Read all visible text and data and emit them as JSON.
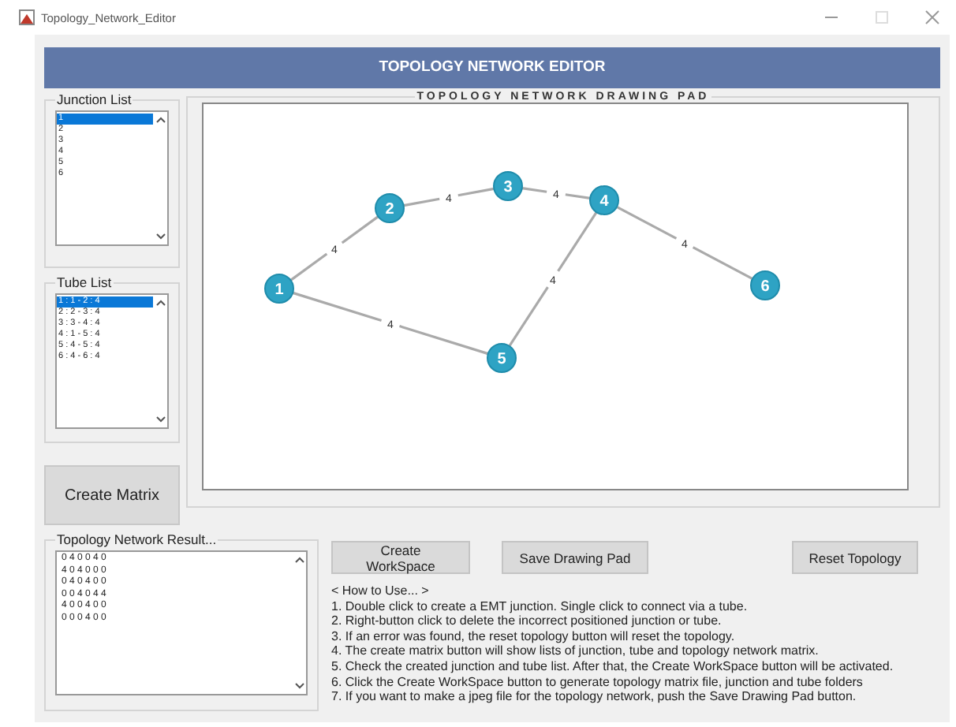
{
  "window": {
    "title": "Topology_Network_Editor"
  },
  "header": {
    "title": "TOPOLOGY NETWORK EDITOR"
  },
  "junction_list": {
    "title": "Junction List",
    "items": [
      {
        "label": "1",
        "selected": true
      },
      {
        "label": "2",
        "selected": false
      },
      {
        "label": "3",
        "selected": false
      },
      {
        "label": "4",
        "selected": false
      },
      {
        "label": "5",
        "selected": false
      },
      {
        "label": "6",
        "selected": false
      }
    ]
  },
  "tube_list": {
    "title": "Tube List",
    "items": [
      {
        "label": "1 : 1 - 2 : 4",
        "selected": true
      },
      {
        "label": "2 : 2 - 3 : 4",
        "selected": false
      },
      {
        "label": "3 : 3 - 4 : 4",
        "selected": false
      },
      {
        "label": "4 : 1 - 5 : 4",
        "selected": false
      },
      {
        "label": "5 : 4 - 5 : 4",
        "selected": false
      },
      {
        "label": "6 : 4 - 6 : 4",
        "selected": false
      }
    ]
  },
  "create_matrix_button": "Create Matrix",
  "drawing_pad": {
    "title": "TOPOLOGY NETWORK DRAWING PAD",
    "nodes": [
      {
        "label": "1"
      },
      {
        "label": "2"
      },
      {
        "label": "3"
      },
      {
        "label": "4"
      },
      {
        "label": "5"
      },
      {
        "label": "6"
      }
    ],
    "edges": [
      {
        "label": "4"
      },
      {
        "label": "4"
      },
      {
        "label": "4"
      },
      {
        "label": "4"
      },
      {
        "label": "4"
      },
      {
        "label": "4"
      }
    ]
  },
  "result": {
    "title": "Topology Network Result...",
    "rows": [
      "0 4 0 0 4 0",
      "4 0 4 0 0 0",
      "0 4 0 4 0 0",
      "0 0 4 0 4 4",
      "4 0 0 4 0 0",
      "0 0 0 4 0 0"
    ]
  },
  "buttons": [
    "Create WorkSpace",
    "Save Drawing Pad",
    "Reset Topology"
  ],
  "instructions": [
    "< How to Use... >",
    "1. Double click to create a EMT junction. Single click to connect via a tube.",
    "2. Right-button click to delete the incorrect positioned junction or tube.",
    "3. If an error was found, the reset topology button will reset the topology.",
    "4. The create matrix button will show lists of junction, tube and topology network matrix.",
    "5. Check the created junction and tube list. After that, the Create WorkSpace button will be activated.",
    "6. Click the Create WorkSpace button to generate topology matrix file, junction and tube folders",
    "7. If you want to make a jpeg file for the topology network, push the Save Drawing Pad button."
  ]
}
